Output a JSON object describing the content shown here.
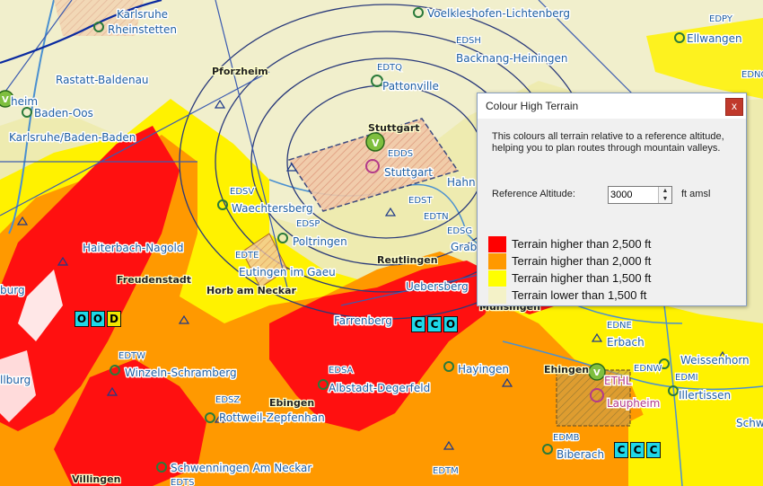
{
  "map": {
    "labels": {
      "karlsruhe": "Karlsruhe",
      "rheinstetten": "Rheinstetten",
      "voelkleshofen": "Voelkleshofen-Lichtenberg",
      "edpy": "EDPY",
      "ellwangen": "Ellwangen",
      "rastatt": "Rastatt-Baldenau",
      "pforzheim": "Pforzheim",
      "edsh": "EDSH",
      "backnang": "Backnang-Heiningen",
      "edtq": "EDTQ",
      "pattonville": "Pattonville",
      "edno": "EDNO",
      "heim": "heim",
      "baden_oos": "Baden-Oos",
      "stuttgart_city": "Stuttgart",
      "karlsruhe_baden": "Karlsruhe/Baden-Baden",
      "edds": "EDDS",
      "stuttgart": "Stuttgart",
      "hahn": "Hahn",
      "edsv": "EDSV",
      "waechtersberg": "Waechtersberg",
      "edst": "EDST",
      "edtn": "EDTN",
      "edsp": "EDSP",
      "poltringen": "Poltringen",
      "edsg": "EDSG",
      "grab": "Grab",
      "haiterbach": "Haiterbach-Nagold",
      "edte": "EDTE",
      "eutingen": "Eutingen im Gaeu",
      "reutlingen": "Reutlingen",
      "freudenstadt": "Freudenstadt",
      "horb": "Horb am Neckar",
      "uebersberg": "Uebersberg",
      "munsingen": "Munsingen",
      "burg": "burg",
      "farrenberg": "Farrenberg",
      "edne": "EDNE",
      "erbach": "Erbach",
      "edtw": "EDTW",
      "winzeln": "Winzeln-Schramberg",
      "edsa": "EDSA",
      "hayingen": "Hayingen",
      "ehingen": "Ehingen",
      "edtl": "ETHL",
      "ednw": "EDNW",
      "edmi": "EDMI",
      "weissenhorn": "Weissenhorn",
      "illbburg": "llburg",
      "albstadt": "Albstadt-Degerfeld",
      "illertissen": "Illertissen",
      "edsz": "EDSZ",
      "ebingen": "Ebingen",
      "laupheim": "Laupheim",
      "rottweil": "Rottweil-Zepfenhan",
      "schw": "Schw",
      "edmb": "EDMB",
      "biberach": "Biberach",
      "schwenningen": "Schwenningen Am Neckar",
      "villingen": "Villingen",
      "edts": "EDTS",
      "edtm": "EDTM",
      "v_symbol": "V"
    },
    "badges": {
      "ood": [
        "O",
        "O",
        "D"
      ],
      "cco_mid": [
        "C",
        "C",
        "O"
      ],
      "ccc": [
        "C",
        "C",
        "C"
      ]
    }
  },
  "dialog": {
    "title": "Colour High Terrain",
    "close_label": "x",
    "description": "This colours all terrain relative to a reference altitude, helping you to plan routes through mountain valleys.",
    "reference_label": "Reference Altitude:",
    "reference_value": "3000",
    "unit": "ft amsl",
    "legend": [
      {
        "label": "Terrain higher than 2,500 ft",
        "color": "#ff0000"
      },
      {
        "label": "Terrain higher than 2,000 ft",
        "color": "#ff9900"
      },
      {
        "label": "Terrain higher than 1,500 ft",
        "color": "#ffff00"
      },
      {
        "label": "Terrain lower than 1,500 ft",
        "color": "#f4f2c8"
      }
    ]
  }
}
